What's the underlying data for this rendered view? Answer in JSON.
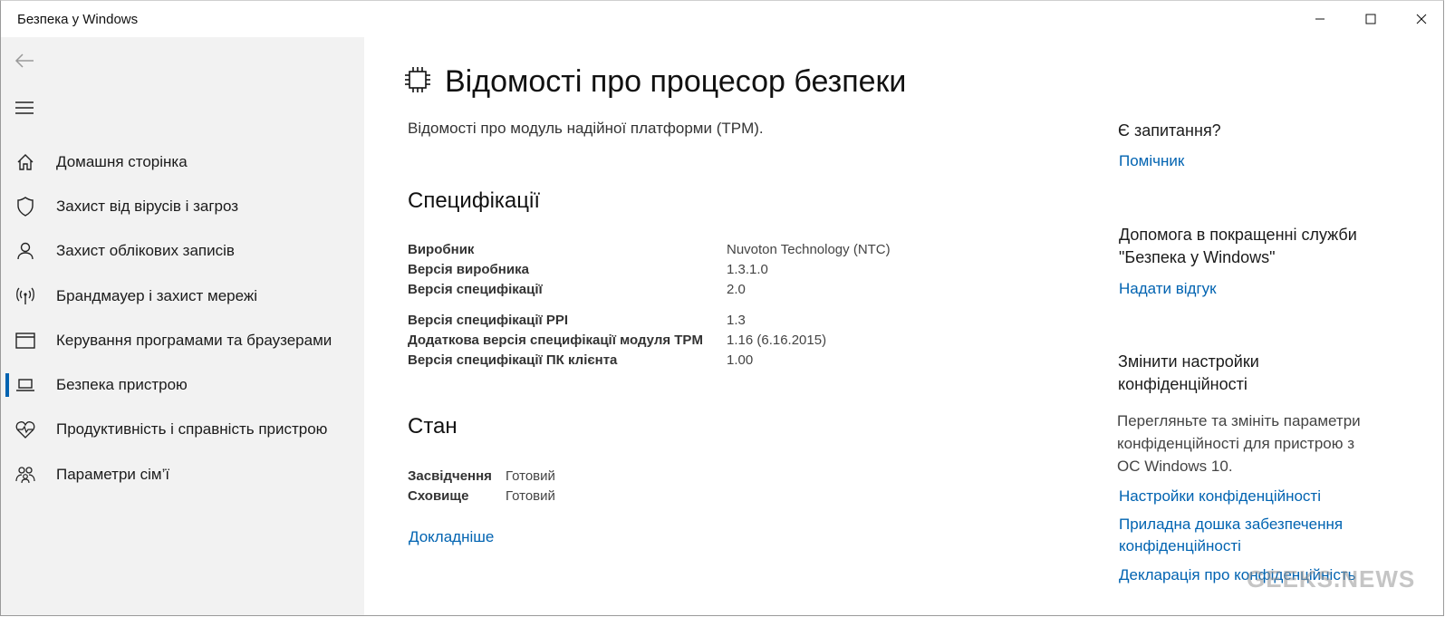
{
  "window": {
    "title": "Безпека у Windows"
  },
  "sidebar": {
    "items": [
      {
        "label": "Домашня сторінка",
        "icon": "home-icon"
      },
      {
        "label": "Захист від вірусів і загроз",
        "icon": "shield-icon"
      },
      {
        "label": "Захист облікових записів",
        "icon": "person-icon"
      },
      {
        "label": "Брандмауер і захист мережі",
        "icon": "wireless-icon"
      },
      {
        "label": "Керування програмами та браузерами",
        "icon": "app-window-icon"
      },
      {
        "label": "Безпека пристрою",
        "icon": "laptop-icon",
        "active": true
      },
      {
        "label": "Продуктивність і справність пристрою",
        "icon": "heart-pulse-icon"
      },
      {
        "label": "Параметри сім’ї",
        "icon": "family-icon"
      }
    ]
  },
  "main": {
    "title": "Відомості про процесор безпеки",
    "subtitle": "Відомості про модуль надійної платформи (TPM).",
    "specs_heading": "Специфікації",
    "specs": [
      {
        "key": "Виробник",
        "value": "Nuvoton Technology (NTC)"
      },
      {
        "key": "Версія виробника",
        "value": "1.3.1.0"
      },
      {
        "key": "Версія специфікації",
        "value": "2.0"
      },
      {
        "key": "Версія специфікації PPI",
        "value": "1.3"
      },
      {
        "key": "Додаткова версія специфікації модуля TPM",
        "value": "1.16 (6.16.2015)"
      },
      {
        "key": "Версія специфікації ПК клієнта",
        "value": "1.00"
      }
    ],
    "status_heading": "Стан",
    "status": [
      {
        "key": "Засвідчення",
        "value": "Готовий"
      },
      {
        "key": "Сховище",
        "value": "Готовий"
      }
    ],
    "more_link": "Докладніше"
  },
  "aside": {
    "question_heading": "Є запитання?",
    "helper_link": "Помічник",
    "improve_heading_line1": "Допомога в покращенні служби",
    "improve_heading_line2": "\"Безпека у Windows\"",
    "feedback_link": "Надати відгук",
    "privacy_heading_line1": "Змінити настройки",
    "privacy_heading_line2": "конфіденційності",
    "privacy_text_line1": "Перегляньте та змініть параметри",
    "privacy_text_line2": "конфіденційності для пристрою з",
    "privacy_text_line3": "ОС Windows 10.",
    "privacy_settings_link": "Настройки конфіденційності",
    "dashboard_link_line1": "Приладна дошка забезпечення",
    "dashboard_link_line2": "конфіденційності",
    "statement_link": "Декларація про конфіденційність"
  },
  "watermark": "GEEKS.NEWS",
  "colors": {
    "accent": "#0063b1",
    "sidebar_bg": "#f2f2f2"
  }
}
